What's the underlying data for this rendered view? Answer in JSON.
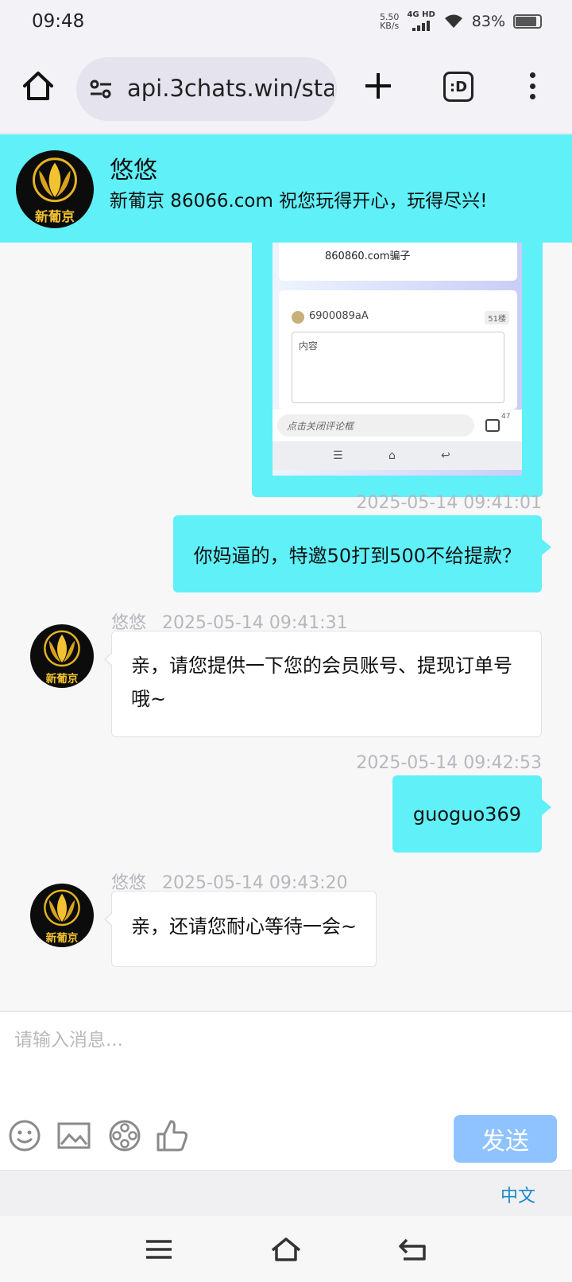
{
  "status_bar": {
    "time": "09:48",
    "net_speed_value": "5.50",
    "net_speed_unit": "KB/s",
    "network": "4G HD",
    "battery": "83%"
  },
  "browser": {
    "url": "api.3chats.win/sta"
  },
  "header": {
    "agent_name": "悠悠",
    "slogan": "新葡京 86066.com 祝您玩得开心，玩得尽兴!",
    "logo_text": "新葡京"
  },
  "image_message": {
    "post_text": "860860.com骗子",
    "username": "6900089aA",
    "floor": "51楼",
    "content_placeholder": "内容",
    "comment_input": "点击关闭评论框",
    "comment_count": "47"
  },
  "messages": [
    {
      "side": "right",
      "time": "2025-05-14 09:41:01",
      "text": "你妈逼的，特邀50打到500不给提款？"
    },
    {
      "side": "left",
      "name": "悠悠",
      "time": "2025-05-14 09:41:31",
      "text": "亲，请您提供一下您的会员账号、提现订单号哦~"
    },
    {
      "side": "right",
      "time": "2025-05-14 09:42:53",
      "text": "guoguo369"
    },
    {
      "side": "left",
      "name": "悠悠",
      "time": "2025-05-14 09:43:20",
      "text": "亲，还请您耐心等待一会~"
    }
  ],
  "composer": {
    "placeholder": "请输入消息...",
    "send_label": "发送",
    "tools": [
      "emoji-icon",
      "image-icon",
      "video-icon",
      "thumbs-up-icon"
    ]
  },
  "language": "中文",
  "colors": {
    "accent": "#5ff0f8",
    "send_button": "#8ec3ff",
    "timestamp": "#b7b7bd",
    "link": "#1a88c9"
  }
}
